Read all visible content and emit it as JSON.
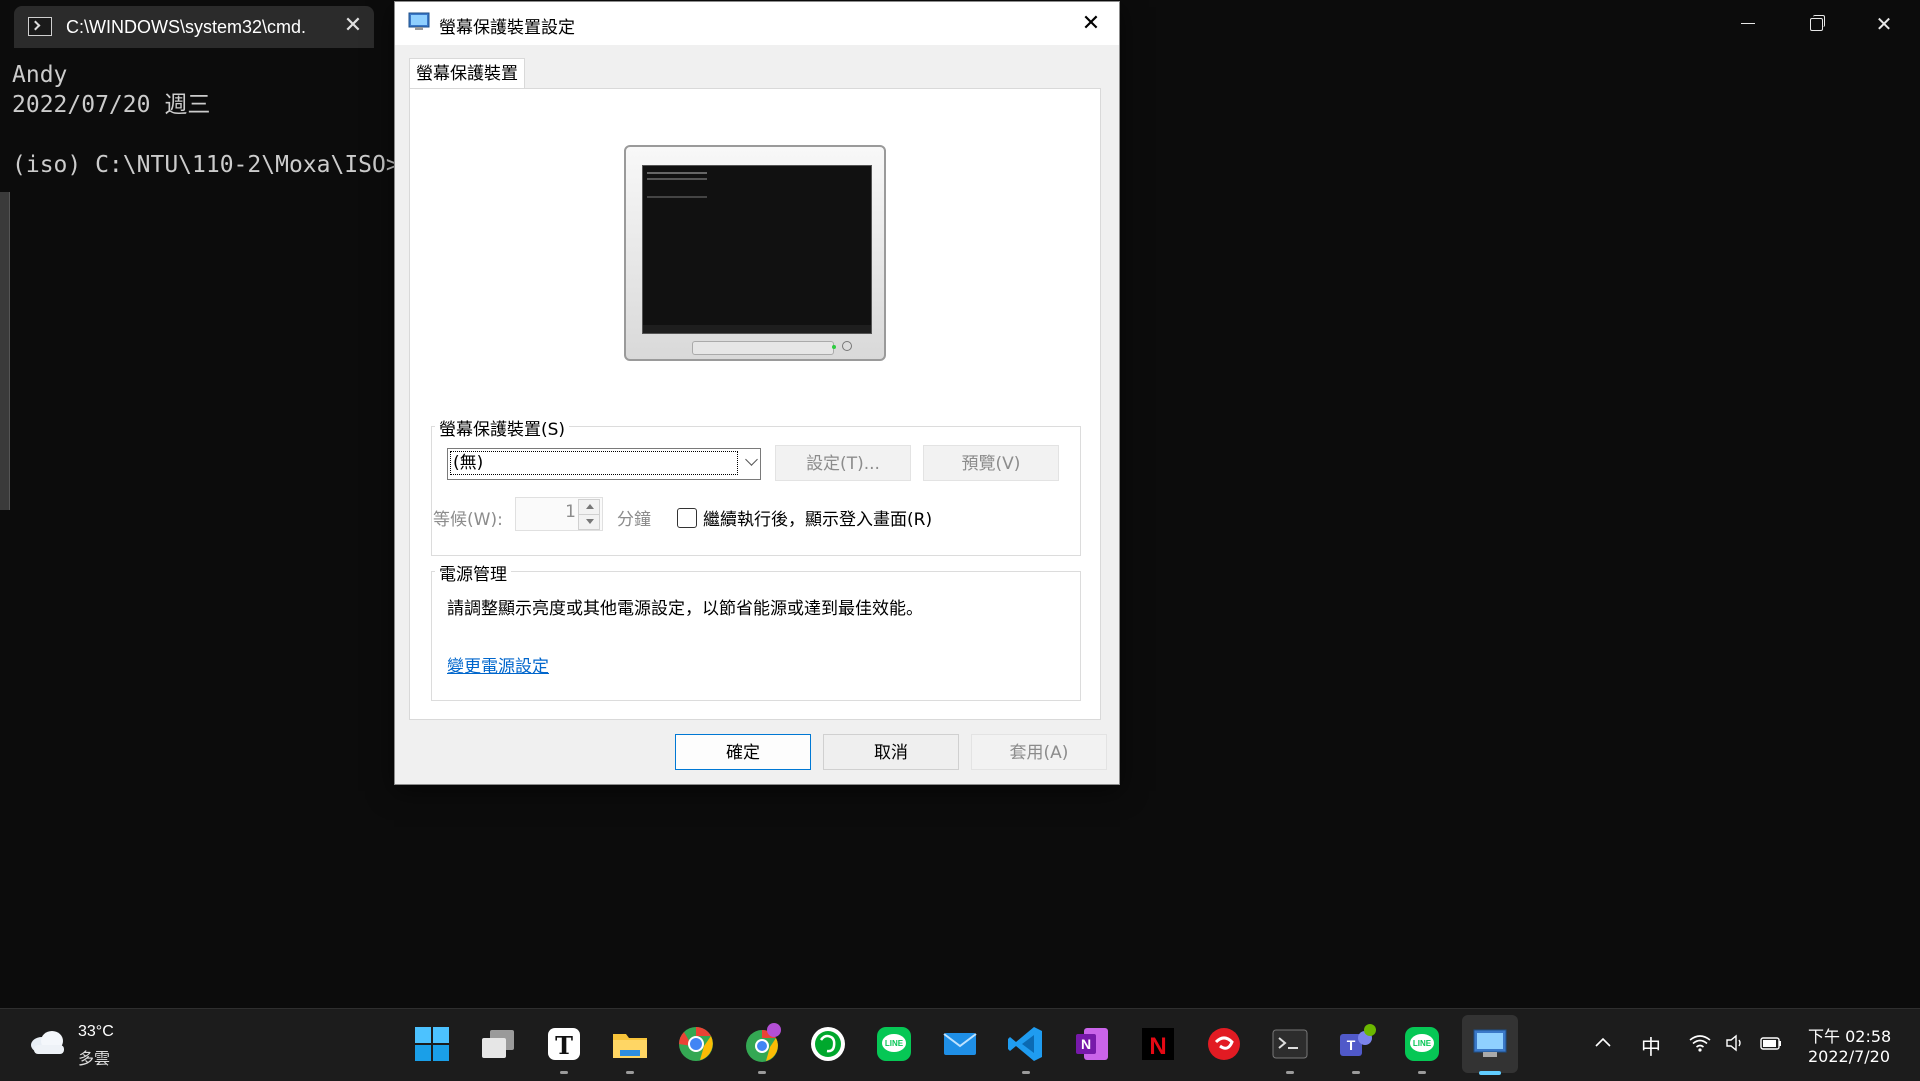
{
  "terminal": {
    "tab_title": "C:\\WINDOWS\\system32\\cmd.",
    "tab_close": "✕",
    "lines": [
      "Andy",
      "2022/07/20 週三",
      "",
      "(iso) C:\\NTU\\110-2\\Moxa\\ISO>"
    ]
  },
  "window_controls": {
    "minimize": "",
    "maximize": "",
    "close": "✕"
  },
  "dialog": {
    "title": "螢幕保護裝置設定",
    "close": "✕",
    "tab": "螢幕保護裝置",
    "screensaver_group": {
      "label": "螢幕保護裝置(S)",
      "selected": "(無)",
      "settings_button": "設定(T)...",
      "preview_button": "預覽(V)",
      "wait_label": "等候(W):",
      "wait_value": "1",
      "minutes_label": "分鐘",
      "resume_checkbox_label": "繼續執行後，顯示登入畫面(R)",
      "resume_checked": false
    },
    "power_group": {
      "label": "電源管理",
      "description": "請調整顯示亮度或其他電源設定，以節省能源或達到最佳效能。",
      "link": "變更電源設定"
    },
    "buttons": {
      "ok": "確定",
      "cancel": "取消",
      "apply": "套用(A)"
    }
  },
  "taskbar": {
    "weather": {
      "temp": "33°C",
      "desc": "多雲"
    },
    "apps": [
      "start",
      "task-view",
      "typora",
      "file-explorer",
      "chrome",
      "chrome-profile",
      "evernote",
      "line",
      "mail",
      "vscode",
      "onenote",
      "netflix",
      "garena",
      "terminal",
      "teams",
      "line-2",
      "screensaver-settings"
    ],
    "tray": {
      "ime": "中"
    },
    "clock": {
      "time": "下午 02:58",
      "date": "2022/7/20"
    }
  },
  "colors": {
    "accent": "#0078d4",
    "link": "#0066cc",
    "taskbar": "#1c1c1c",
    "terminal_bg": "#0c0c0c"
  }
}
